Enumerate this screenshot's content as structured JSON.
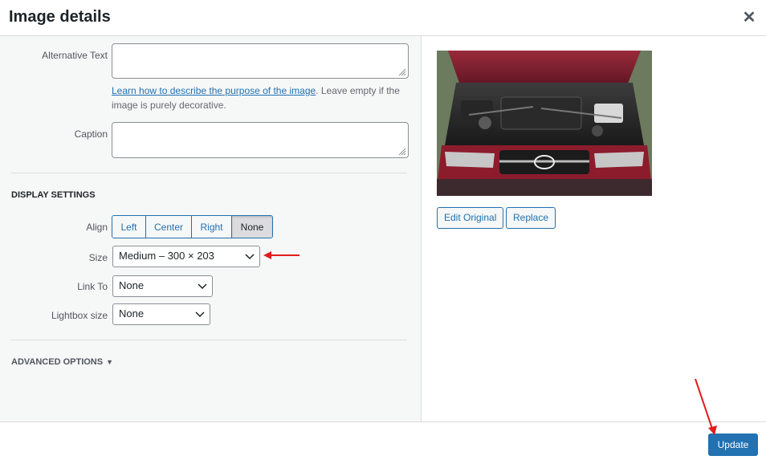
{
  "modal": {
    "title": "Image details",
    "close_icon": "close-icon"
  },
  "fields": {
    "alt_text": {
      "label": "Alternative Text",
      "value": ""
    },
    "help": {
      "link": "Learn how to describe the purpose of the image",
      "text": ". Leave empty if the image is purely decorative."
    },
    "caption": {
      "label": "Caption",
      "value": ""
    }
  },
  "display_settings": {
    "title": "DISPLAY SETTINGS",
    "align": {
      "label": "Align",
      "options": [
        "Left",
        "Center",
        "Right",
        "None"
      ],
      "selected": "None"
    },
    "size": {
      "label": "Size",
      "value": "Medium – 300 × 203"
    },
    "link_to": {
      "label": "Link To",
      "value": "None"
    },
    "lightbox": {
      "label": "Lightbox size",
      "value": "None"
    }
  },
  "advanced": {
    "label": "ADVANCED OPTIONS",
    "icon": "triangle-down-icon"
  },
  "preview": {
    "image": "car-engine-photo",
    "edit_label": "Edit Original",
    "replace_label": "Replace"
  },
  "footer": {
    "update_label": "Update"
  },
  "colors": {
    "accent": "#2271b1",
    "annotation": "#e31b1b"
  }
}
